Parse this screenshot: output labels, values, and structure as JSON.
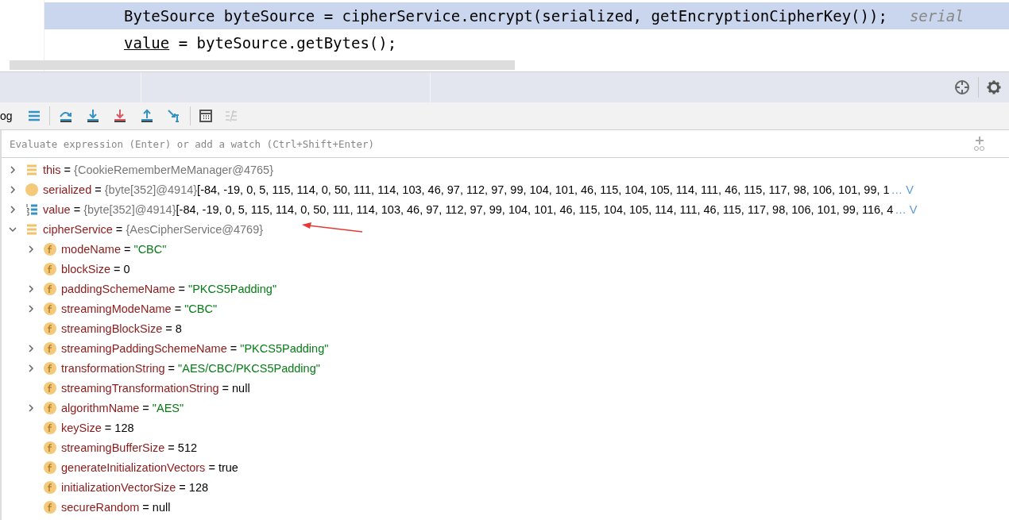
{
  "editor": {
    "lines": [
      {
        "code": "ByteSource byteSource = cipherService.encrypt(serialized, getEncryptionCipherKey());",
        "hint": "serial",
        "highlighted": true
      },
      {
        "code": "value",
        "rest": " = byteSource.getBytes();",
        "highlighted": false
      }
    ]
  },
  "toolbar": {
    "label": "og",
    "buttons": [
      {
        "kind": "menu",
        "disabled": false
      },
      {
        "kind": "step-over",
        "disabled": false
      },
      {
        "kind": "step-into",
        "disabled": false
      },
      {
        "kind": "force-step-into",
        "disabled": false
      },
      {
        "kind": "step-out",
        "disabled": false
      },
      {
        "kind": "run-to-cursor",
        "disabled": false
      },
      {
        "kind": "evaluate",
        "disabled": false
      },
      {
        "kind": "trace",
        "disabled": true
      }
    ]
  },
  "watch": {
    "placeholder": "Evaluate expression (Enter) or add a watch (Ctrl+Shift+Enter)"
  },
  "variables": [
    {
      "kind": "object",
      "name": "this",
      "op": "=",
      "type": "{CookieRememberMeManager@4765}",
      "expanded": false
    },
    {
      "kind": "param",
      "name": "serialized",
      "op": "=",
      "type": "{byte[352]@4914}",
      "value": "[-84, -19, 0, 5, 115, 114, 0, 50, 111, 114, 103, 46, 97, 112, 97, 99, 104, 101, 46, 115, 104, 105, 114, 111, 46, 115, 117, 98, 106, 101, 99, 1",
      "link": "… V",
      "expanded": false
    },
    {
      "kind": "array",
      "name": "value",
      "op": "=",
      "type": "{byte[352]@4914}",
      "value": "[-84, -19, 0, 5, 115, 114, 0, 50, 111, 114, 103, 46, 97, 112, 97, 99, 104, 101, 46, 115, 104, 105, 114, 111, 46, 115, 117, 98, 106, 101, 99, 116, 4",
      "link": "… V",
      "expanded": false
    },
    {
      "kind": "object",
      "name": "cipherService",
      "op": "=",
      "type": "{AesCipherService@4769}",
      "expanded": true,
      "children": [
        {
          "kind": "string",
          "name": "modeName",
          "op": "=",
          "value": "\"CBC\"",
          "expanded": false
        },
        {
          "kind": "plain",
          "name": "blockSize",
          "op": "=",
          "value": "0"
        },
        {
          "kind": "string",
          "name": "paddingSchemeName",
          "op": "=",
          "value": "\"PKCS5Padding\"",
          "expanded": false
        },
        {
          "kind": "string",
          "name": "streamingModeName",
          "op": "=",
          "value": "\"CBC\"",
          "expanded": false
        },
        {
          "kind": "plain",
          "name": "streamingBlockSize",
          "op": "=",
          "value": "8"
        },
        {
          "kind": "string",
          "name": "streamingPaddingSchemeName",
          "op": "=",
          "value": "\"PKCS5Padding\"",
          "expanded": false
        },
        {
          "kind": "string",
          "name": "transformationString",
          "op": "=",
          "value": "\"AES/CBC/PKCS5Padding\"",
          "expanded": false
        },
        {
          "kind": "plain",
          "name": "streamingTransformationString",
          "op": "=",
          "value": "null"
        },
        {
          "kind": "string",
          "name": "algorithmName",
          "op": "=",
          "value": "\"AES\"",
          "expanded": false
        },
        {
          "kind": "plain",
          "name": "keySize",
          "op": "=",
          "value": "128"
        },
        {
          "kind": "plain",
          "name": "streamingBufferSize",
          "op": "=",
          "value": "512"
        },
        {
          "kind": "plain",
          "name": "generateInitializationVectors",
          "op": "=",
          "value": "true"
        },
        {
          "kind": "plain",
          "name": "initializationVectorSize",
          "op": "=",
          "value": "128"
        },
        {
          "kind": "plain",
          "name": "secureRandom",
          "op": "=",
          "value": "null"
        }
      ]
    }
  ]
}
